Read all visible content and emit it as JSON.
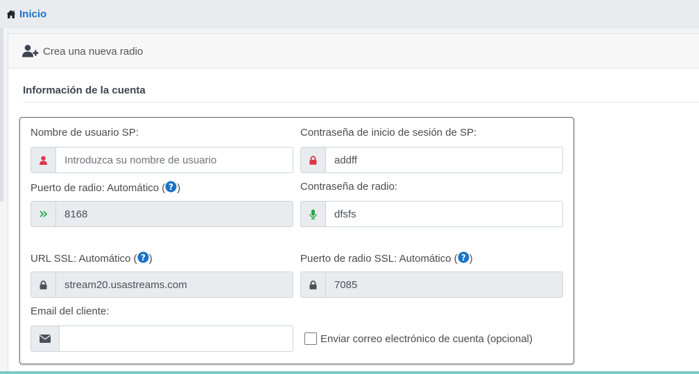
{
  "nav": {
    "home_label": "Inicio"
  },
  "card": {
    "header_title": "Crea una nueva radio",
    "section_title": "Información de la cuenta"
  },
  "form": {
    "username": {
      "label": "Nombre de usuario SP:",
      "placeholder": "Introduzca su nombre de usuario",
      "value": "",
      "icon": "user-icon",
      "icon_color": "#dc3545"
    },
    "password": {
      "label": "Contraseña de inicio de sesión de SP:",
      "value": "addff",
      "icon": "lock-icon",
      "icon_color": "#dc3545"
    },
    "radio_port": {
      "label": "Puerto de radio: Automático (",
      "label_end": ")",
      "value": "8168",
      "icon": "chevrons-right-icon",
      "icon_color": "#28a745"
    },
    "radio_password": {
      "label": "Contraseña de radio:",
      "value": "dfsfs",
      "icon": "microphone-icon",
      "icon_color": "#28a745"
    },
    "ssl_url": {
      "label": "URL SSL: Automático (",
      "label_end": ")",
      "value": "stream20.usastreams.com",
      "icon": "lock-icon"
    },
    "ssl_port": {
      "label": "Puerto de radio SSL: Automático (",
      "label_end": ")",
      "value": "7085",
      "icon": "lock-icon"
    },
    "client_email": {
      "label": "Email del cliente:",
      "value": "",
      "icon": "envelope-icon"
    },
    "send_email": {
      "label": "Enviar correo electrónico de cuenta (opcional)",
      "checked": false
    }
  },
  "colors": {
    "link": "#1a73c8",
    "help": "#1a73c8",
    "accent_strip": "#7cc9c6"
  }
}
